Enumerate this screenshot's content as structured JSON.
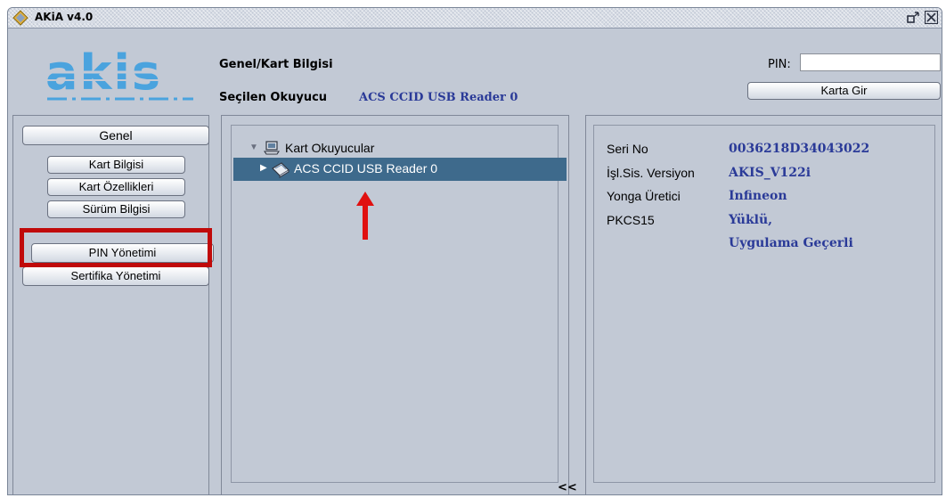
{
  "window": {
    "title": "AKiA v4.0",
    "logo_text": "akis"
  },
  "header": {
    "section_title": "Genel/Kart Bilgisi",
    "reader_label": "Seçilen Okuyucu",
    "reader_value": "ACS CCID USB Reader 0",
    "pin_label": "PIN:",
    "pin_value": "",
    "karta_gir_label": "Karta Gir"
  },
  "sidebar": {
    "genel_label": "Genel",
    "items": [
      {
        "label": "Kart Bilgisi"
      },
      {
        "label": "Kart Özellikleri"
      },
      {
        "label": "Sürüm Bilgisi"
      }
    ],
    "pin_yonetimi_label": "PIN Yönetimi",
    "sertifika_yonetimi_label": "Sertifika Yönetimi"
  },
  "tree": {
    "root_label": "Kart Okuyucular",
    "selected_label": "ACS CCID USB Reader 0"
  },
  "info": {
    "rows": [
      {
        "label": "Seri No",
        "value": "0036218D34043022"
      },
      {
        "label": "İşl.Sis. Versiyon",
        "value": "AKIS_V122i"
      },
      {
        "label": "Yonga Üretici",
        "value": "Infineon"
      },
      {
        "label": "PKCS15",
        "value": "Yüklü,"
      },
      {
        "label": "",
        "value": "Uygulama Geçerli"
      }
    ]
  },
  "footer": {
    "collapse_label": "<<"
  },
  "colors": {
    "background": "#c2c9d5",
    "selection": "#3e6a8c",
    "value_text": "#2a3a98",
    "highlight": "#c00a0a",
    "logo": "#3f9ad6"
  }
}
